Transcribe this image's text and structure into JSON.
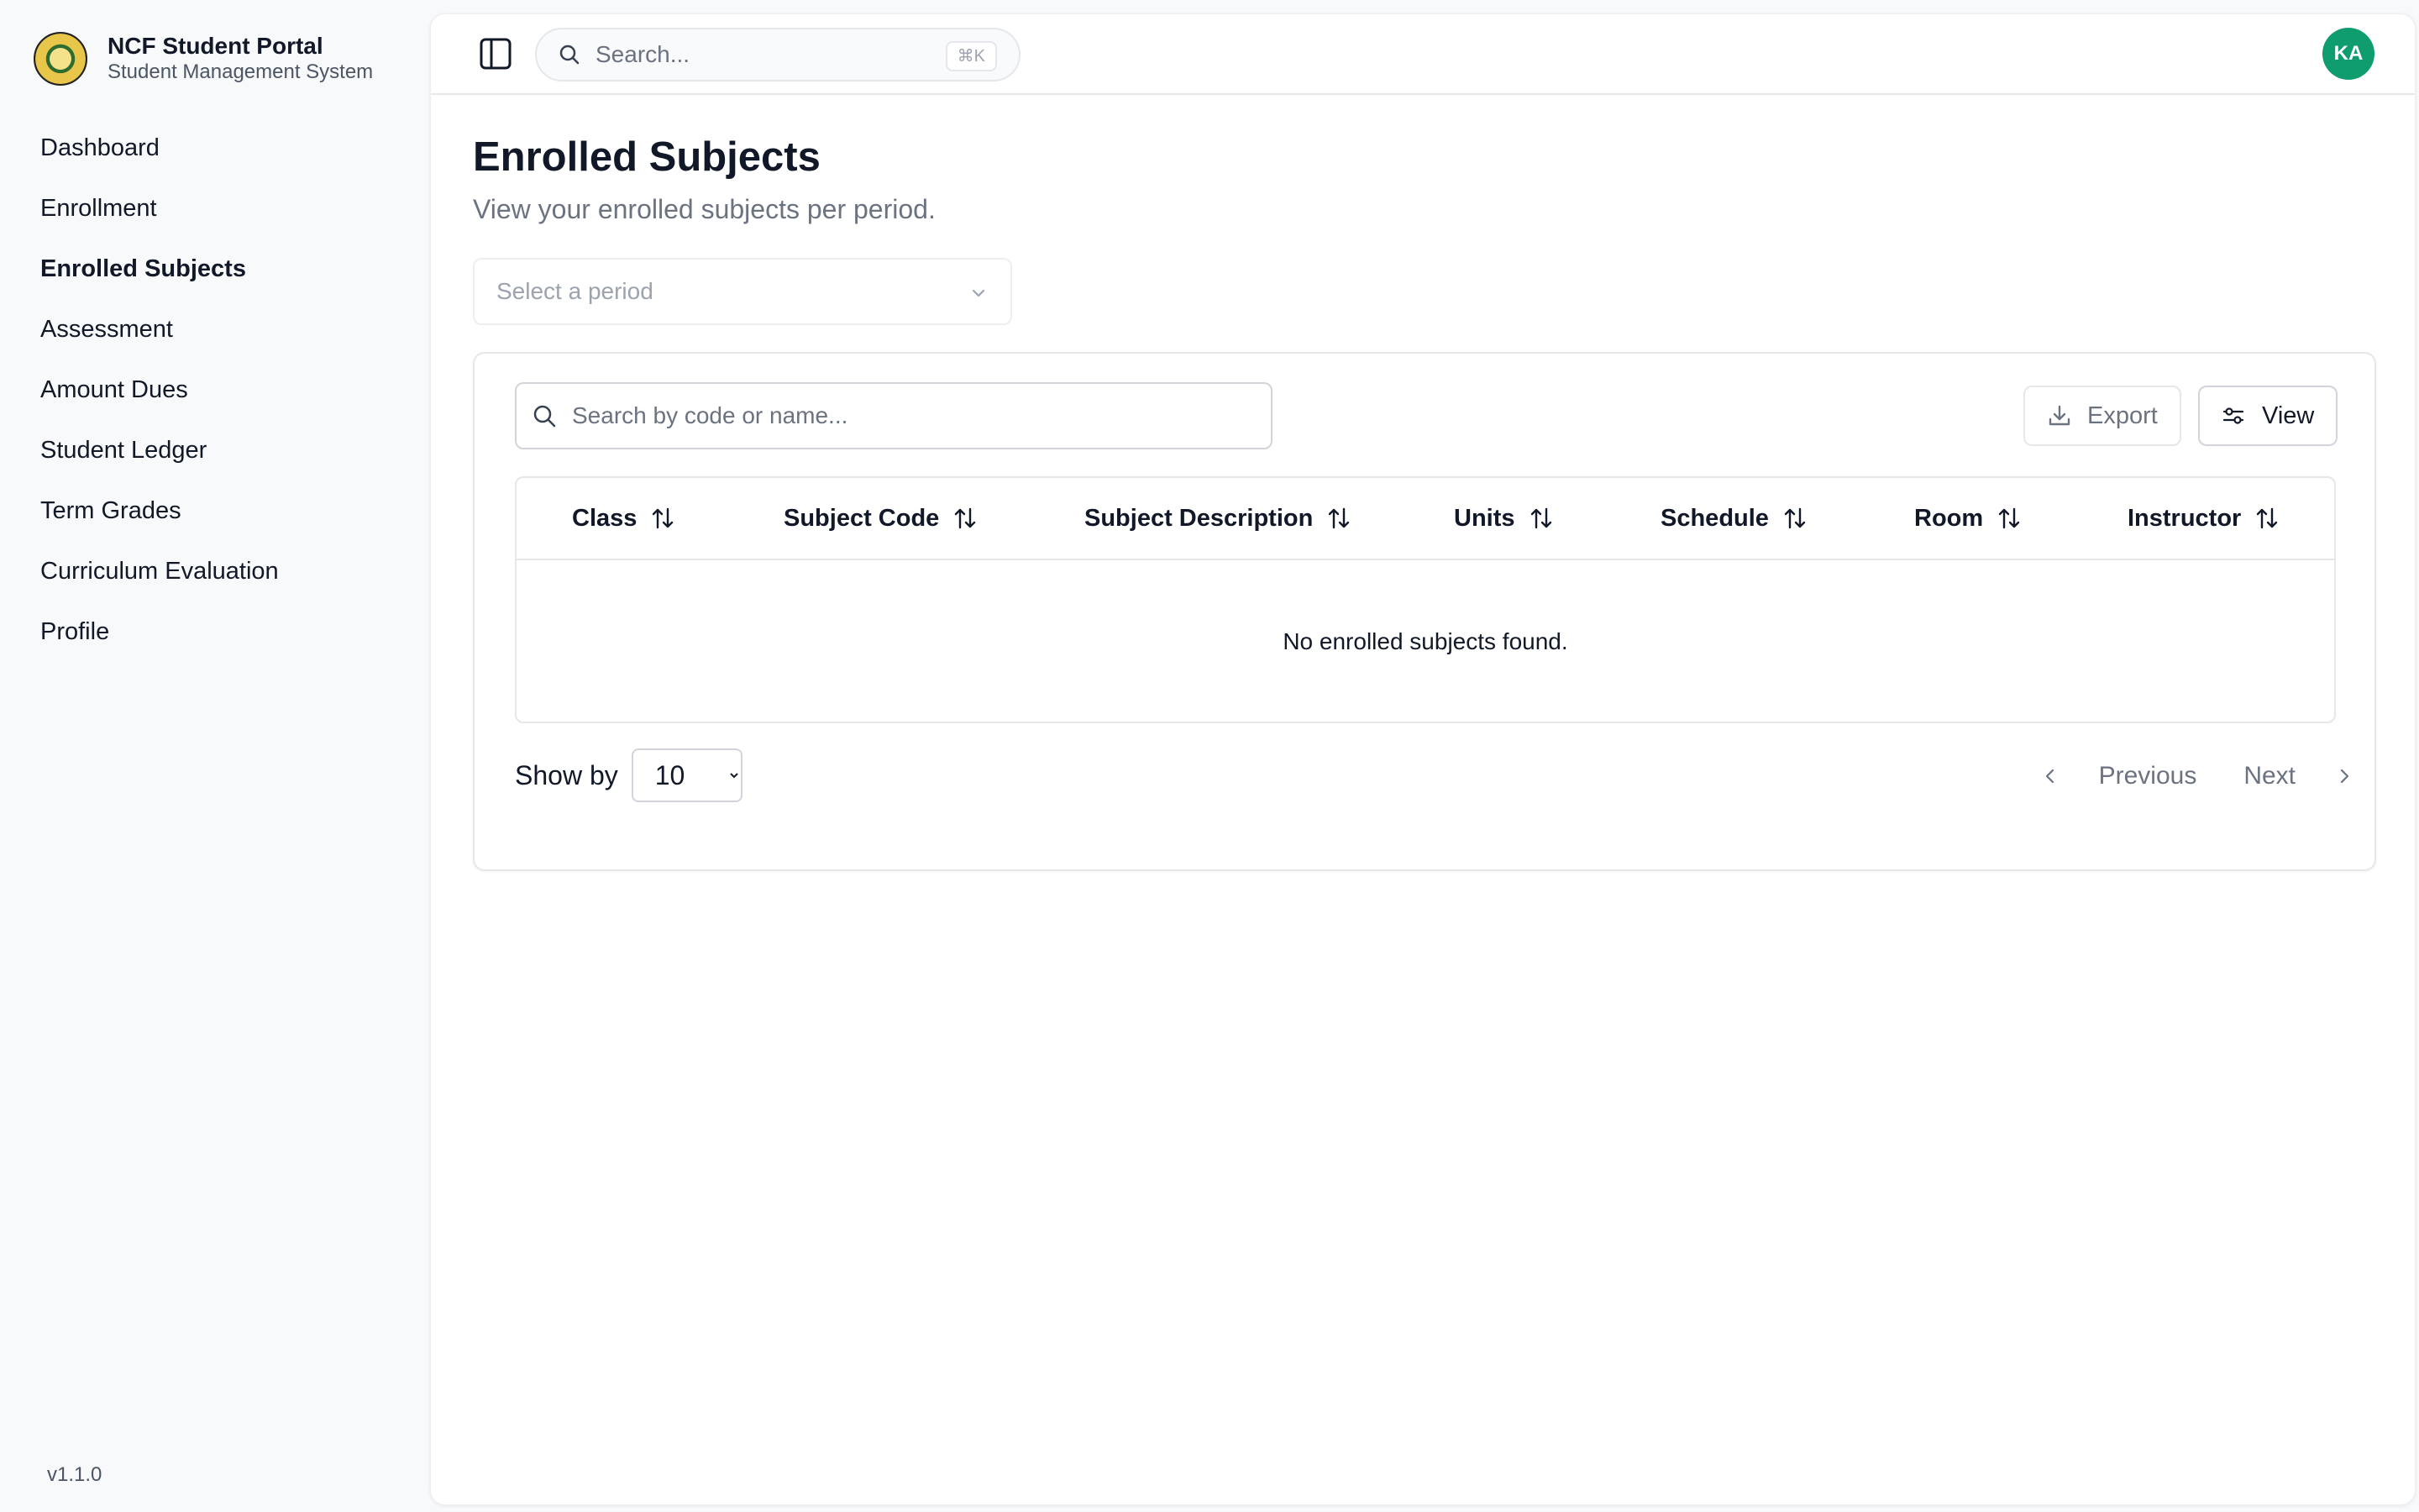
{
  "app": {
    "title": "NCF Student Portal",
    "subtitle": "Student Management System",
    "version": "v1.1.0"
  },
  "sidebar": {
    "items": [
      {
        "label": "Dashboard",
        "active": false
      },
      {
        "label": "Enrollment",
        "active": false
      },
      {
        "label": "Enrolled Subjects",
        "active": true
      },
      {
        "label": "Assessment",
        "active": false
      },
      {
        "label": "Amount Dues",
        "active": false
      },
      {
        "label": "Student Ledger",
        "active": false
      },
      {
        "label": "Term Grades",
        "active": false
      },
      {
        "label": "Curriculum Evaluation",
        "active": false
      },
      {
        "label": "Profile",
        "active": false
      }
    ]
  },
  "header": {
    "search_placeholder": "Search...",
    "shortcut": "⌘K",
    "avatar_initials": "KA",
    "avatar_color": "#0f9d6f"
  },
  "page": {
    "title": "Enrolled Subjects",
    "subtitle": "View your enrolled subjects per period.",
    "period_placeholder": "Select a period"
  },
  "table": {
    "search_placeholder": "Search by code or name...",
    "export_label": "Export",
    "view_label": "View",
    "columns": [
      "Class",
      "Subject Code",
      "Subject Description",
      "Units",
      "Schedule",
      "Room",
      "Instructor"
    ],
    "empty_message": "No enrolled subjects found.",
    "rows": []
  },
  "pagination": {
    "show_by_label": "Show by",
    "page_size": "10",
    "page_size_options": [
      "10"
    ],
    "previous_label": "Previous",
    "next_label": "Next"
  }
}
